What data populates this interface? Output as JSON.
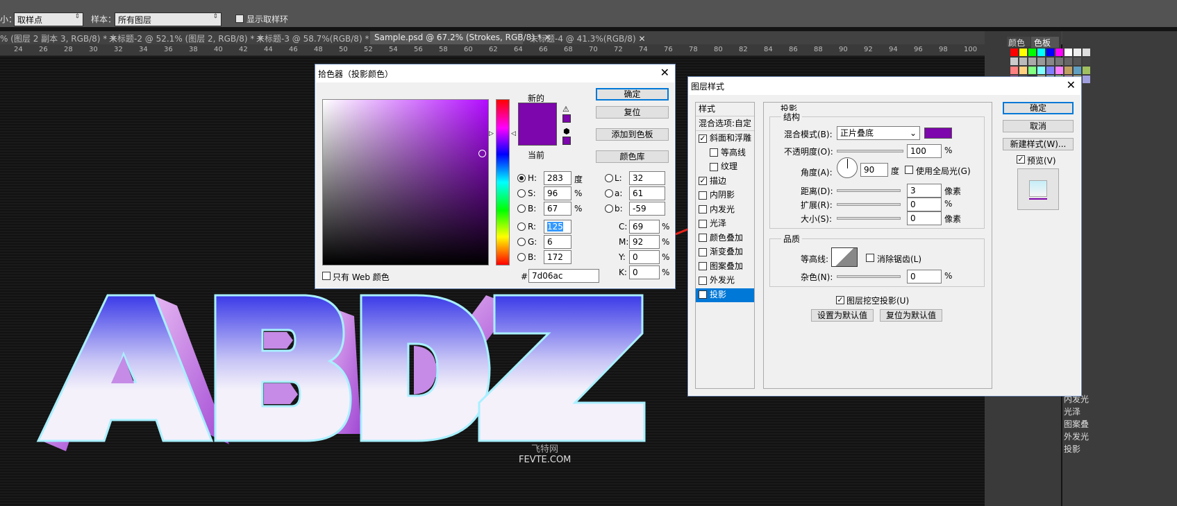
{
  "options": {
    "size_label": "小：",
    "sample_size": "取样点",
    "sample_label": "样本：",
    "sample_value": "所有图层",
    "show_ring": "显示取样环"
  },
  "tabs": [
    "% (图层 2 副本 3, RGB/8) *",
    "未标题-2 @ 52.1% (图层 2, RGB/8) *",
    "未标题-3 @ 58.7%(RGB/8) *",
    "Sample.psd @ 67.2% (Strokes, RGB/8) *",
    "未标题-4 @ 41.3%(RGB/8)"
  ],
  "ruler": [
    "24",
    "26",
    "28",
    "30",
    "32",
    "34",
    "36",
    "38",
    "40",
    "42",
    "44",
    "46",
    "48",
    "50",
    "52",
    "54",
    "56",
    "58",
    "60",
    "62",
    "64",
    "66",
    "68",
    "70",
    "72",
    "74",
    "76",
    "78",
    "80",
    "82",
    "84",
    "86",
    "88",
    "90",
    "92",
    "94",
    "96",
    "98",
    "100"
  ],
  "picker": {
    "title": "拾色器（投影颜色）",
    "new_label": "新的",
    "current_label": "当前",
    "new_color": "#7d06ac",
    "current_color": "#7d06ac",
    "ok": "确定",
    "reset": "复位",
    "add_swatch": "添加到色板",
    "color_lib": "颜色库",
    "web_only": "只有 Web 颜色",
    "hex_label": "#",
    "hex": "7d06ac",
    "hsb": [
      {
        "k": "H:",
        "v": "283",
        "u": "度"
      },
      {
        "k": "S:",
        "v": "96",
        "u": "%"
      },
      {
        "k": "B:",
        "v": "67",
        "u": "%"
      }
    ],
    "rgb": [
      {
        "k": "R:",
        "v": "125"
      },
      {
        "k": "G:",
        "v": "6"
      },
      {
        "k": "B:",
        "v": "172"
      }
    ],
    "lab": [
      {
        "k": "L:",
        "v": "32"
      },
      {
        "k": "a:",
        "v": "61"
      },
      {
        "k": "b:",
        "v": "-59"
      }
    ],
    "cmyk": [
      {
        "k": "C:",
        "v": "69",
        "u": "%"
      },
      {
        "k": "M:",
        "v": "92",
        "u": "%"
      },
      {
        "k": "Y:",
        "v": "0",
        "u": "%"
      },
      {
        "k": "K:",
        "v": "0",
        "u": "%"
      }
    ]
  },
  "style": {
    "title": "图层样式",
    "list_header": "样式",
    "blend_options": "混合选项:自定",
    "items": [
      {
        "label": "斜面和浮雕",
        "checked": true
      },
      {
        "label": "等高线",
        "checked": false
      },
      {
        "label": "纹理",
        "checked": false
      },
      {
        "label": "描边",
        "checked": true
      },
      {
        "label": "内阴影",
        "checked": false
      },
      {
        "label": "内发光",
        "checked": false
      },
      {
        "label": "光泽",
        "checked": false
      },
      {
        "label": "颜色叠加",
        "checked": false
      },
      {
        "label": "渐变叠加",
        "checked": false
      },
      {
        "label": "图案叠加",
        "checked": false
      },
      {
        "label": "外发光",
        "checked": false
      },
      {
        "label": "投影",
        "checked": true
      }
    ],
    "section": "投影",
    "struct": "结构",
    "blend_mode_label": "混合模式(B):",
    "blend_mode": "正片叠底",
    "shadow_color": "#7d06ac",
    "opacity_label": "不透明度(O):",
    "opacity": "100",
    "angle_label": "角度(A):",
    "angle": "90",
    "deg": "度",
    "global_light": "使用全局光(G)",
    "distance_label": "距离(D):",
    "distance": "3",
    "spread_label": "扩展(R):",
    "spread": "0",
    "size_label": "大小(S):",
    "size": "0",
    "px": "像素",
    "pct": "%",
    "quality": "品质",
    "contour_label": "等高线:",
    "antialias": "消除锯齿(L)",
    "noise_label": "杂色(N):",
    "noise": "0",
    "knockout": "图层挖空投影(U)",
    "set_default": "设置为默认值",
    "reset_default": "复位为默认值",
    "ok": "确定",
    "cancel": "取消",
    "new_style": "新建样式(W)...",
    "preview": "预览(V)"
  },
  "right_panel": {
    "tab1": "颜色",
    "tab2": "色板",
    "fx": [
      "内发光",
      "光泽",
      "图案叠",
      "外发光",
      "投影"
    ]
  },
  "artwork": {
    "letters": "ABDZ",
    "watermark1": "飞特网",
    "watermark2": "FEVTE.COM"
  }
}
